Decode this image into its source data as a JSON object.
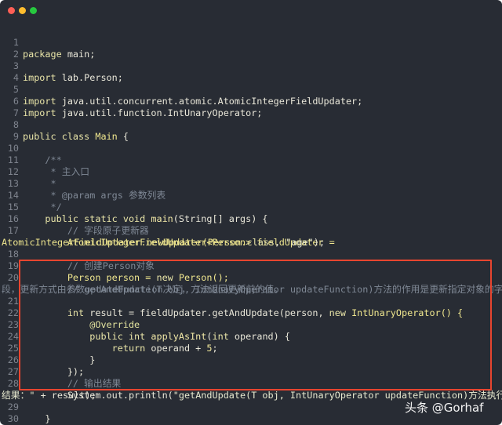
{
  "window": {
    "traffic_lights": {
      "close_color": "#ff5f56",
      "minimize_color": "#ffbd2e",
      "maximize_color": "#27c93f"
    }
  },
  "code": {
    "line_numbers": [
      "1",
      "2",
      "3",
      "4",
      "5",
      "6",
      "7",
      "8",
      "9",
      "10",
      "11",
      "12",
      "13",
      "14",
      "15",
      "16",
      "17",
      "18",
      "19",
      "20",
      "21",
      "22",
      "23",
      "24",
      "25",
      "26",
      "27",
      "28",
      "29",
      "30"
    ],
    "l1": {
      "kw": "package",
      "rest": " main;"
    },
    "l3": {
      "kw": "import",
      "rest": " lab.Person;"
    },
    "l5": {
      "kw": "import",
      "rest": " java.util.concurrent.atomic.AtomicIntegerFieldUpdater;"
    },
    "l6": {
      "kw": "import",
      "rest": " java.util.function.IntUnaryOperator;"
    },
    "l8": {
      "kw": "public class",
      "cls": " Main",
      "rest": " {"
    },
    "l10": "    /**",
    "l11": "     * 主入口",
    "l12": "     *",
    "l13": "     * @param args 参数列表",
    "l14": "     */",
    "l15": {
      "indent": "    ",
      "kw": "public static void",
      "fn": " main",
      "rest": "(String[] args) {"
    },
    "l16": "        // 字段原子更新器",
    "l17": {
      "text": "        AtomicIntegerFieldUpdater<Person> fieldUpdater =",
      "wrap_a": "AtomicIntegerFieldUpdater.newUpdater(Person.",
      "wrap_kw": "class",
      "wrap_b": ", ",
      "wrap_str": "\"age\"",
      "wrap_c": ");"
    },
    "l18": "        // 创建Person对象",
    "l19": {
      "indent": "        ",
      "a": "Person person = ",
      "kw": "new",
      "b": " Person();"
    },
    "l20": {
      "text": "        // getAndUpdate(T obj, IntUnaryOperator updateFunction)方法的作用是更新指定对象的字",
      "wrap": "段，更新方式由参数updateFunction决定，方法返回更新前的值。"
    },
    "l21": {
      "indent": "        ",
      "kw": "int",
      "a": " result = fieldUpdater.getAndUpdate(person, ",
      "kw2": "new",
      "b": " IntUnaryOperator() {"
    },
    "l22": {
      "indent": "            ",
      "ann": "@Override"
    },
    "l23": {
      "indent": "            ",
      "kw": "public int",
      "fn": " applyAsInt",
      "a": "(",
      "kw2": "int",
      "b": " operand) {"
    },
    "l24": {
      "indent": "                ",
      "kw": "return",
      "a": " operand + ",
      "num": "5",
      "b": ";"
    },
    "l25": "            }",
    "l26": "        });",
    "l27": "        // 输出结果",
    "l28": {
      "indent": "        ",
      "a": "System.out.println(",
      "str": "\"getAndUpdate(T obj, IntUnaryOperator updateFunction)方法执行",
      "wrap_str": "结果：\"",
      "wrap_rest": " + result);"
    },
    "l29": "    }",
    "l30": "}"
  },
  "highlight_color": "#e8452f",
  "watermark": "头条 @Gorhaf"
}
